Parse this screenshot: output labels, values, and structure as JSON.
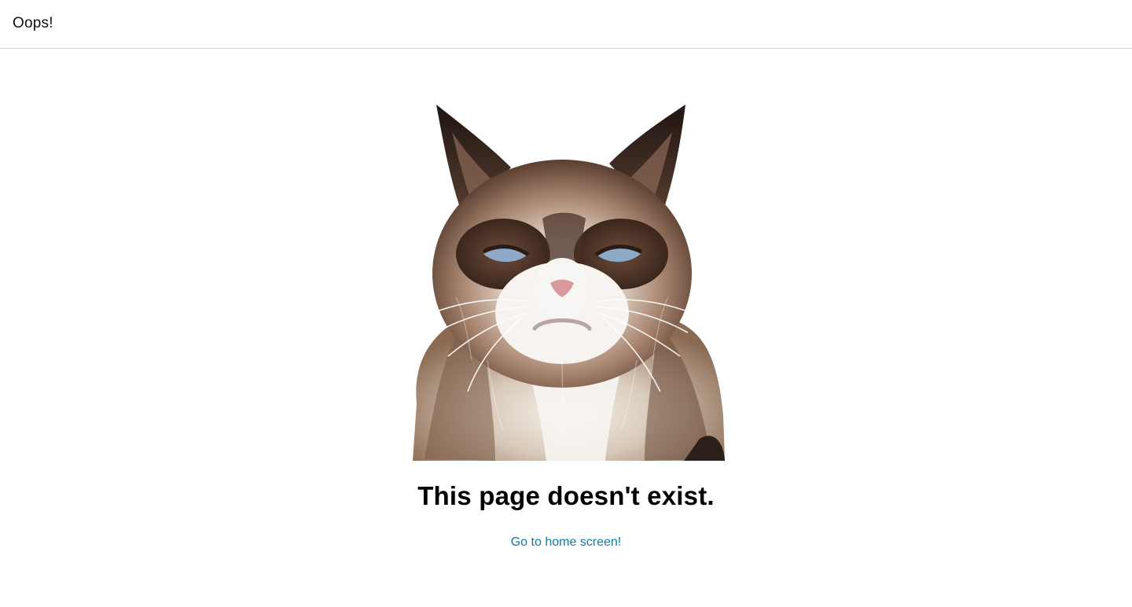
{
  "header": {
    "title": "Oops!"
  },
  "main": {
    "image": {
      "icon": "grumpy-cat-image"
    },
    "headline": "This page doesn't exist.",
    "home_link_label": "Go to home screen!"
  },
  "colors": {
    "link": "#0a7ea4",
    "divider": "#d8d8d8",
    "background": "#ffffff"
  }
}
